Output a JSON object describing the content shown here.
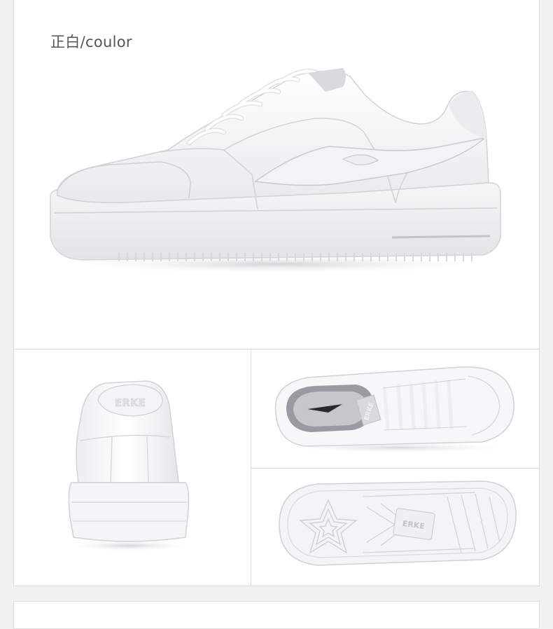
{
  "main": {
    "color_label": "正白/coulor"
  },
  "product": {
    "brand_mark": "ERKE",
    "shoe_color": "#f7f7f8",
    "shade_color": "#d9d9dd",
    "stitch_color": "#c9c9ce"
  },
  "page": {
    "background": "#f1f1f1",
    "panel_background": "#ffffff",
    "panel_border": "#dcdcdc"
  }
}
